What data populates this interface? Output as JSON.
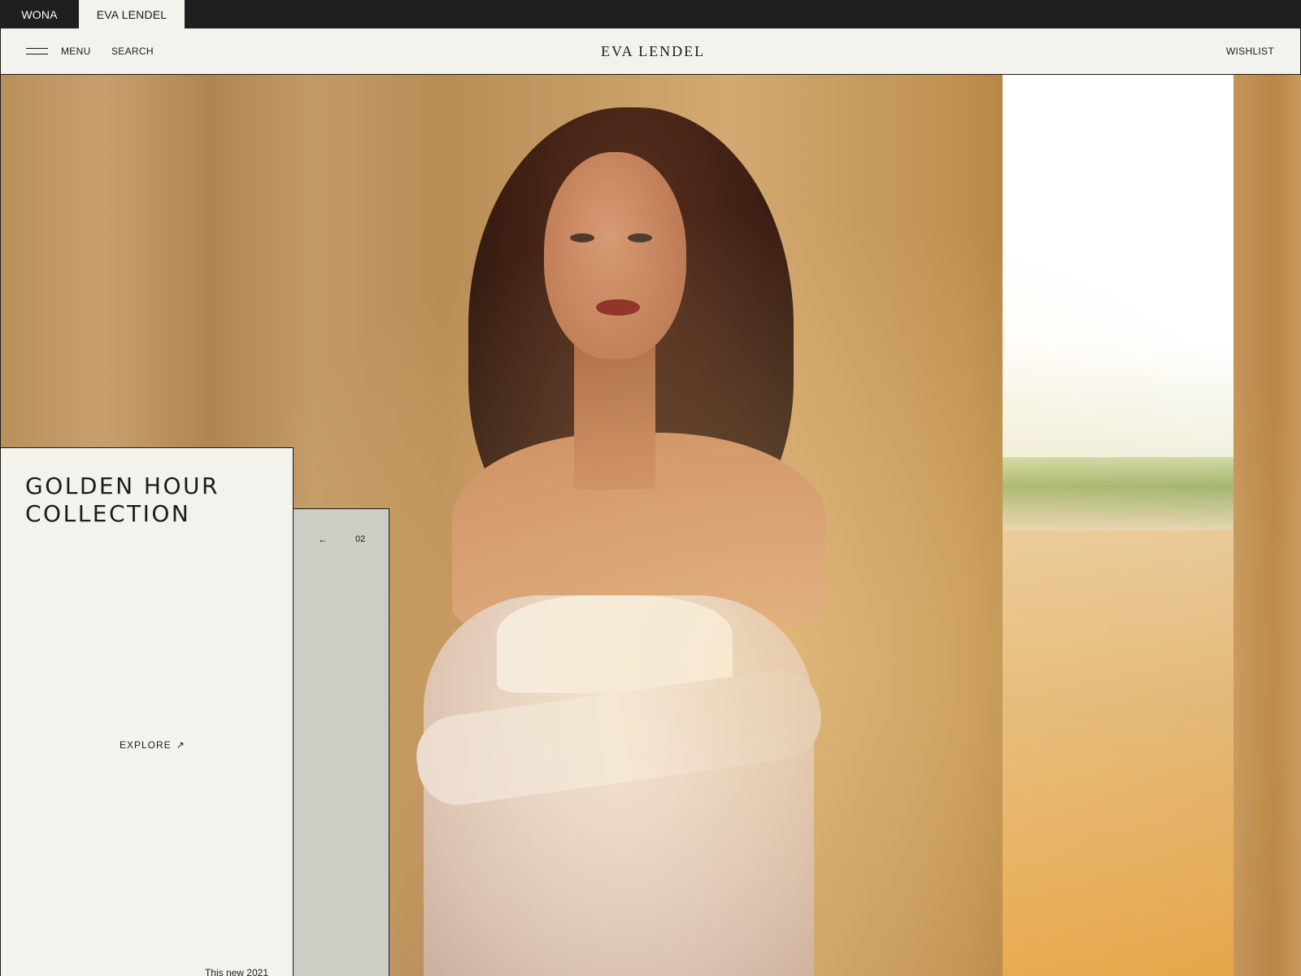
{
  "brand_tabs": [
    {
      "label": "WONA",
      "active": false
    },
    {
      "label": "EVA LENDEL",
      "active": true
    }
  ],
  "header": {
    "menu_label": "MENU",
    "search_label": "SEARCH",
    "logo_text": "EVA LENDEL",
    "wishlist_label": "WISHLIST"
  },
  "hero": {
    "collection_title": "GOLDEN HOUR COLLECTION",
    "explore_label": "EXPLORE",
    "explore_icon": "arrow-up-right-icon",
    "caption": "This new 2021",
    "prev_icon": "arrow-left-icon",
    "slide_number": "02"
  },
  "colors": {
    "dark_bar": "#1f1e20",
    "cream": "#f3f2ec",
    "pager_grey": "#cdccc5",
    "text": "#1c1b1a"
  }
}
